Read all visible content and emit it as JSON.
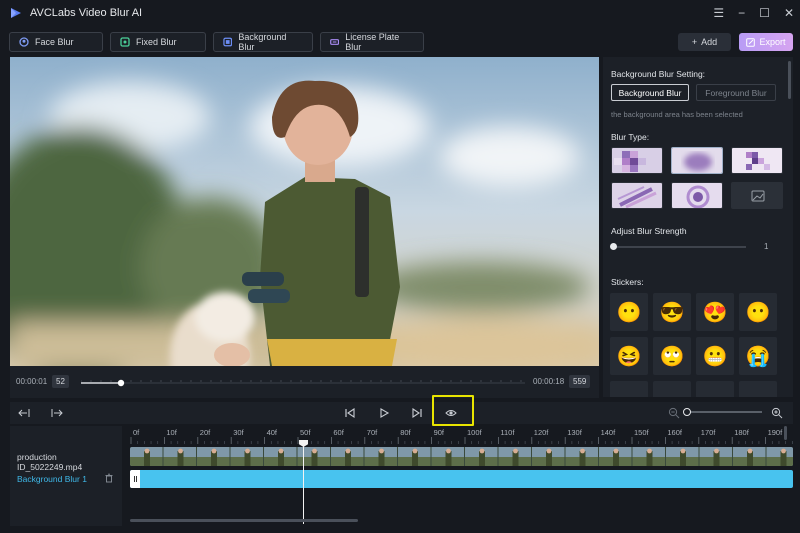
{
  "app": {
    "title": "AVCLabs Video Blur AI",
    "window_controls": [
      "menu-icon",
      "minimize-icon",
      "maximize-icon",
      "close-icon"
    ]
  },
  "modes": [
    {
      "label": "Face Blur",
      "icon": "face-icon"
    },
    {
      "label": "Fixed Blur",
      "icon": "fixed-blur-icon"
    },
    {
      "label": "Background Blur",
      "icon": "background-blur-icon"
    },
    {
      "label": "License Plate Blur",
      "icon": "license-plate-icon"
    }
  ],
  "actions": {
    "add_label": "Add",
    "export_label": "Export"
  },
  "player": {
    "current_time": "00:00:01",
    "current_frame": "52",
    "end_time": "00:00:18",
    "total_frames": "559"
  },
  "panel": {
    "setting_title": "Background Blur Setting:",
    "options": [
      "Background Blur",
      "Foreground Blur"
    ],
    "selected_option": "Background Blur",
    "note": "the background area has been selected",
    "blur_type_title": "Blur Type:",
    "blur_types": [
      "mosaic",
      "gaussian",
      "pixelate",
      "motion-scatter",
      "radial",
      "custom-image"
    ],
    "selected_blur_type": "gaussian",
    "strength_title": "Adjust Blur Strength",
    "strength_value": "1",
    "stickers_title": "Stickers:",
    "stickers": [
      "😶",
      "😎",
      "😍",
      "😶",
      "😆",
      "🙄",
      "😬",
      "😭"
    ]
  },
  "timeline": {
    "ruler_labels": [
      "0f",
      "10f",
      "20f",
      "30f",
      "40f",
      "50f",
      "60f",
      "70f",
      "80f",
      "90f",
      "100f",
      "110f",
      "120f",
      "130f",
      "140f",
      "150f",
      "160f",
      "170f",
      "180f",
      "190f"
    ],
    "video_track_label": "production ID_5022249.mp4",
    "blur_track_label": "Background Blur 1"
  },
  "colors": {
    "accent_blue": "#48c3ef",
    "export_gradient": [
      "#b89cf5",
      "#d6a4f0"
    ],
    "highlight": "#e8e400"
  }
}
